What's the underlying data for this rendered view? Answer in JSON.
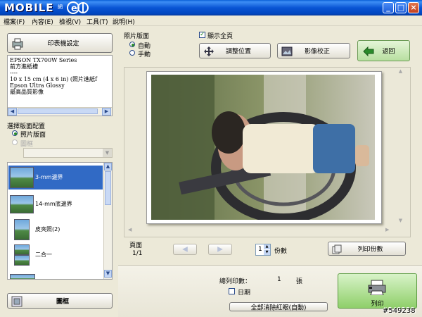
{
  "window": {
    "title": "MOBILE",
    "min_icon": "minimize-icon",
    "max_icon": "maximize-icon",
    "close_icon": "close-icon"
  },
  "menu": [
    "檔案(F)",
    "內容(E)",
    "檢視(V)",
    "工具(T)",
    "說明(H)"
  ],
  "printer": {
    "settings_button": "印表機設定",
    "info_lines": [
      "EPSON TX700W Series",
      "前方進紙槽",
      "----",
      "10 x 15 cm (4 x 6 in) (照片進紙f",
      "Epson Ultra Glossy",
      "最高品質影像"
    ]
  },
  "layout": {
    "section_label": "選擇版面配置",
    "options": [
      {
        "label": "照片版面",
        "selected": true
      },
      {
        "label": "圖框",
        "selected": false
      }
    ],
    "items": [
      "3-mm邊界",
      "14-mm底邊界",
      "皮夾照(2)",
      "二合一"
    ],
    "frame_button": "圖框"
  },
  "orientation": {
    "label": "照片版面",
    "options": [
      {
        "label": "自動",
        "selected": true
      },
      {
        "label": "手動",
        "selected": false
      }
    ]
  },
  "show_all": {
    "label": "顯示全頁",
    "checked": true
  },
  "toolbar": {
    "adjust": "調整位置",
    "correct": "影像校正",
    "back": "返回"
  },
  "pager": {
    "label": "頁面",
    "value": "1/1"
  },
  "copies": {
    "value": "1",
    "label": "份數",
    "print_copies_button": "列印份數"
  },
  "footer": {
    "total_label": "總列印數：",
    "total_value": "1",
    "total_unit": "張",
    "date_label": "日期",
    "clear_button": "全部消除紅眼(自動)",
    "print_button": "列印"
  },
  "watermark": "#549238",
  "colors": {
    "titlebar": "#0a55d4",
    "accent_green": "#2a8a2a",
    "window_bg": "#ece9d8"
  }
}
